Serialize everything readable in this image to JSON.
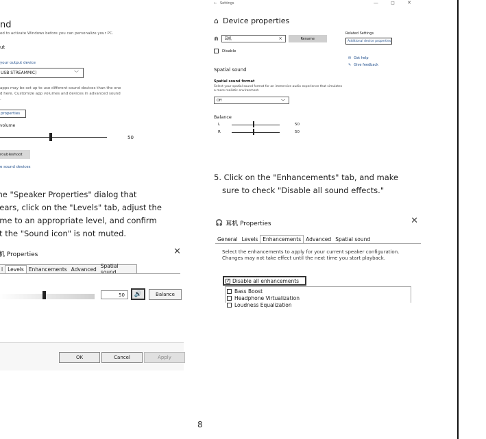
{
  "left_settings": {
    "title": "nd",
    "activate_note": "ed to activate Windows before you can personalize your PC.",
    "output_heading": "ut",
    "choose_label": "your output device",
    "device_value": "USB STREAMMIC)",
    "para_line1": "apps may be set up to use different sound devices than the one",
    "para_line2": "d here. Customize app volumes and devices in advanced sound",
    "para_line3": ".",
    "device_props_link": "properties",
    "volume_label": "volume",
    "volume_value": "50",
    "volume_level": 0.5,
    "troubleshoot_label": "roubleshoot",
    "manage_link": "e sound devices"
  },
  "step4": {
    "line1": "the \"Speaker Properties\" dialog that",
    "line2": "pears, click on the \"Levels\" tab, adjust the",
    "line3": "ume to an appropriate level, and confirm",
    "line4": "at the \"Sound icon\" is not muted."
  },
  "left_dialog": {
    "title": "机 Properties",
    "close": "✕",
    "tabs": [
      "l",
      "Levels",
      "Enhancements",
      "Advanced",
      "Spatial sound"
    ],
    "active_tab": "Levels",
    "level_value": "50",
    "level_fraction": 0.5,
    "speaker_icon": "speaker-icon",
    "balance_label": "Balance",
    "ok_label": "OK",
    "cancel_label": "Cancel",
    "apply_label": "Apply"
  },
  "device_window": {
    "app_name": "Settings",
    "window_controls": "— ◻ ✕",
    "title": "Device properties",
    "name_value": "耳机",
    "rename_label": "Rename",
    "disable_label": "Disable",
    "related_heading": "Related Settings",
    "additional_link": "Additional device properties",
    "get_help": "Get help",
    "give_feedback": "Give feedback",
    "spatial_heading": "Spatial sound",
    "format_label": "Spatial sound format",
    "format_desc": "Select your spatial sound format for an immersive audio experience that simulates a more realistic environment.",
    "format_value": "Off",
    "balance_heading": "Balance",
    "balance_l_label": "L",
    "balance_l_value": "50",
    "balance_r_label": "R",
    "balance_r_value": "50"
  },
  "step5": {
    "line1": "5. Click on the \"Enhancements\" tab, and make",
    "line2": "sure to check \"Disable all sound effects.\""
  },
  "right_dialog": {
    "title": "耳机 Properties",
    "close": "✕",
    "tabs": [
      "General",
      "Levels",
      "Enhancements",
      "Advanced",
      "Spatial sound"
    ],
    "active_tab": "Enhancements",
    "desc": "Select the enhancements to apply for your current speaker configuration. Changes may not take effect until the next time you start playback.",
    "disable_all_label": "Disable all enhancements",
    "disable_all_checked": true,
    "items": [
      "Bass Boost",
      "Headphone Virtualization",
      "Loudness Equalization"
    ]
  },
  "page_number": "8"
}
